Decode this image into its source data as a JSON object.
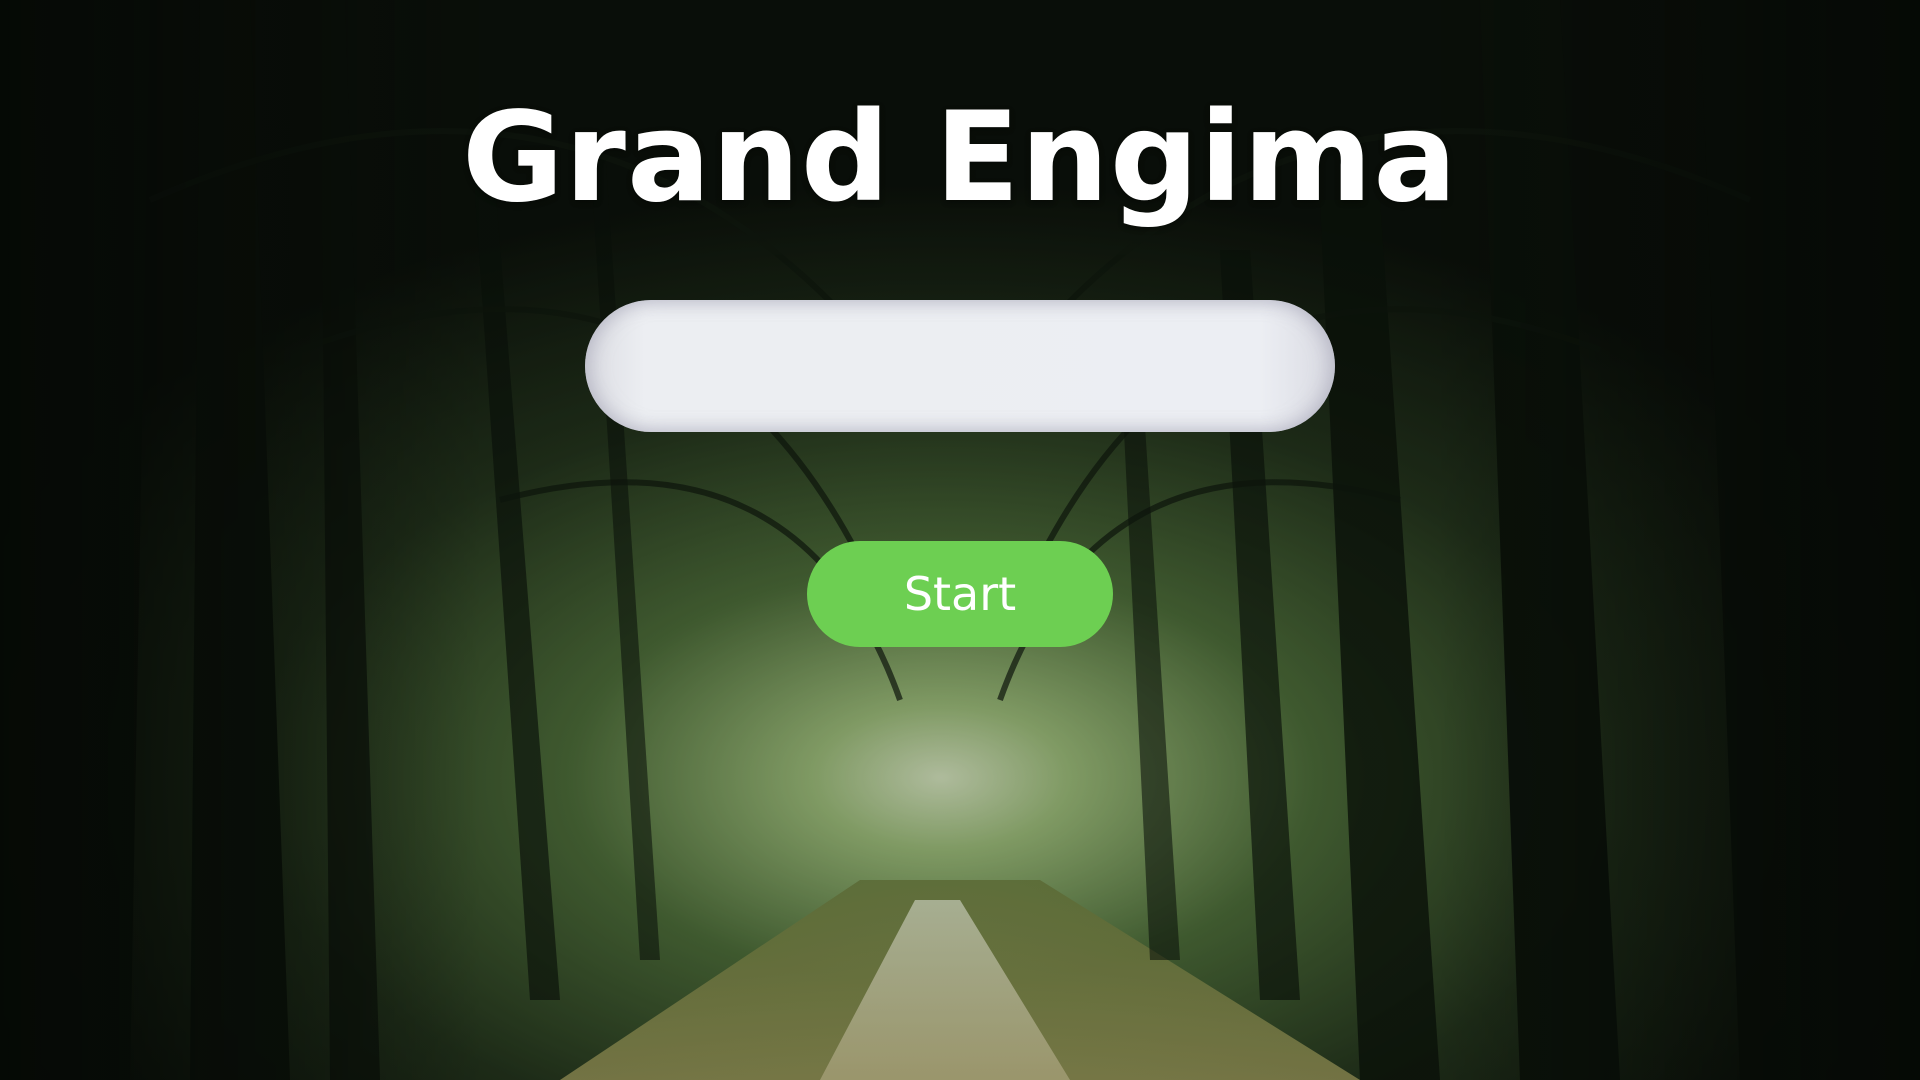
{
  "game": {
    "title": "Grand Engima",
    "name_input": {
      "value": "",
      "placeholder": ""
    },
    "start_button_label": "Start"
  },
  "colors": {
    "title_text": "#ffffff",
    "input_background": "#eceef2",
    "button_background": "#6dcf52",
    "button_text": "#ffffff",
    "forest_dark": "#0e140e",
    "forest_glow": "#cfe3b0"
  }
}
